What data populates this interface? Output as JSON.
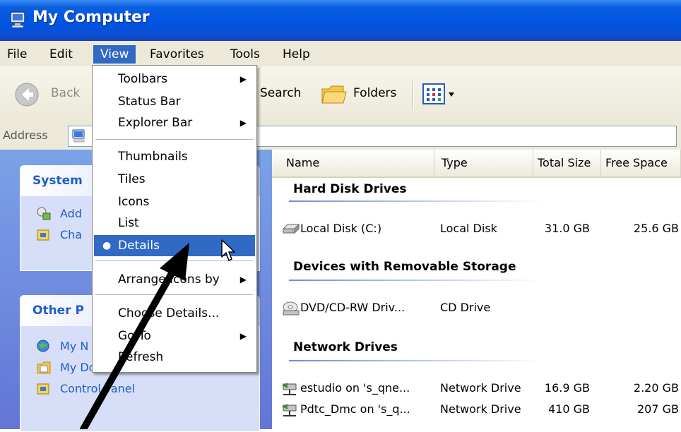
{
  "window": {
    "title": "My Computer"
  },
  "menubar": {
    "items": [
      "File",
      "Edit",
      "View",
      "Favorites",
      "Tools",
      "Help"
    ]
  },
  "toolbar": {
    "back": "Back",
    "search": "Search",
    "folders": "Folders"
  },
  "addressbar": {
    "label": "Address"
  },
  "leftpane": {
    "system": {
      "title": "System",
      "links": [
        "Add",
        "Cha"
      ]
    },
    "other": {
      "title": "Other P",
      "links": [
        "My N",
        "My Documents",
        "Control Panel"
      ]
    }
  },
  "viewmenu": {
    "items": [
      {
        "label": "Toolbars",
        "submenu": true
      },
      {
        "label": "Status Bar",
        "submenu": false
      },
      {
        "label": "Explorer Bar",
        "submenu": true
      },
      {
        "label": "Thumbnails",
        "submenu": false
      },
      {
        "label": "Tiles",
        "submenu": false
      },
      {
        "label": "Icons",
        "submenu": false
      },
      {
        "label": "List",
        "submenu": false
      },
      {
        "label": "Details",
        "submenu": false,
        "selected": true
      },
      {
        "label": "Arrange Icons by",
        "submenu": true
      },
      {
        "label": "Choose Details...",
        "submenu": false
      },
      {
        "label": "Go To",
        "submenu": true
      },
      {
        "label": "Refresh",
        "submenu": false
      }
    ],
    "bullet": "●",
    "arrow": "▶"
  },
  "details": {
    "columns": [
      "Name",
      "Type",
      "Total Size",
      "Free Space"
    ],
    "groups": [
      {
        "title": "Hard Disk Drives",
        "rows": [
          {
            "icon": "hard-disk-icon",
            "name": "Local Disk (C:)",
            "type": "Local Disk",
            "total": "31.0 GB",
            "free": "25.6 GB"
          }
        ]
      },
      {
        "title": "Devices with Removable Storage",
        "rows": [
          {
            "icon": "cd-drive-icon",
            "name": "DVD/CD-RW Driv...",
            "type": "CD Drive",
            "total": "",
            "free": ""
          }
        ]
      },
      {
        "title": "Network Drives",
        "rows": [
          {
            "icon": "network-drive-icon",
            "name": "estudio on 's_qne...",
            "type": "Network Drive",
            "total": "16.9 GB",
            "free": "2.20 GB"
          },
          {
            "icon": "network-drive-icon",
            "name": "Pdtc_Dmc on 's_q...",
            "type": "Network Drive",
            "total": "410 GB",
            "free": "207 GB"
          }
        ]
      }
    ]
  },
  "colors": {
    "titlebar": "#0054e3",
    "highlight": "#316ac5",
    "taskpane": "#7ba2e7",
    "taskLink": "#215dc6"
  }
}
